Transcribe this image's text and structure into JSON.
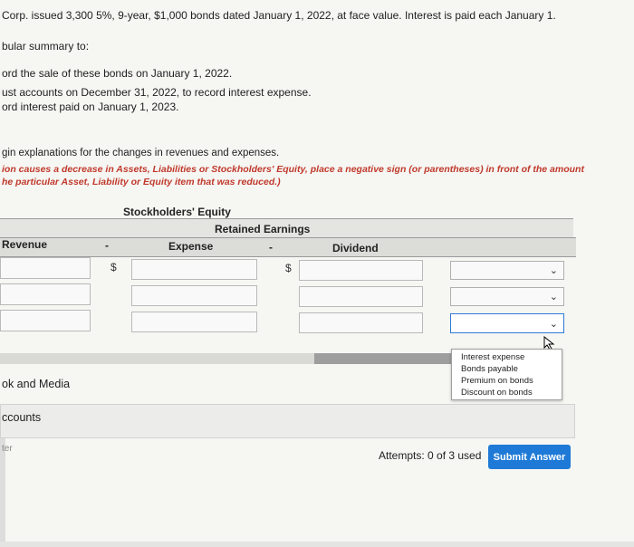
{
  "problem": {
    "line1": "Corp. issued 3,300 5%, 9-year, $1,000 bonds dated January 1, 2022, at face value. Interest is paid each January 1.",
    "line2": "bular summary to:",
    "items": [
      "ord the sale of these bonds on January 1, 2022.",
      "ust accounts on December 31, 2022, to record interest expense.",
      "ord interest paid on January 1, 2023."
    ],
    "instruction1": "gin explanations for the changes in revenues and expenses.",
    "instruction2_line1": "ion causes a decrease in Assets, Liabilities or Stockholders' Equity, place a negative sign (or parentheses) in front of the amount",
    "instruction2_line2": "he particular Asset, Liability or Equity item that was reduced.)"
  },
  "table": {
    "stockholders_equity_label": "Stockholders' Equity",
    "retained_earnings_label": "Retained Earnings",
    "revenue_label": "Revenue",
    "minus1": "-",
    "expense_label": "Expense",
    "minus2": "-",
    "dividend_label": "Dividend",
    "dollar1": "$",
    "dollar2": "$"
  },
  "dropdown": {
    "options": [
      "Interest expense",
      "Bonds payable",
      "Premium on bonds",
      "Discount on bonds"
    ]
  },
  "sections": {
    "book_media": "ok and Media",
    "accounts": "ccounts",
    "enter": "ter"
  },
  "footer": {
    "attempts": "Attempts: 0 of 3 used",
    "submit": "Submit Answer"
  },
  "colors": {
    "accent": "#1e7ad6",
    "instruction_red": "#c0392b"
  }
}
